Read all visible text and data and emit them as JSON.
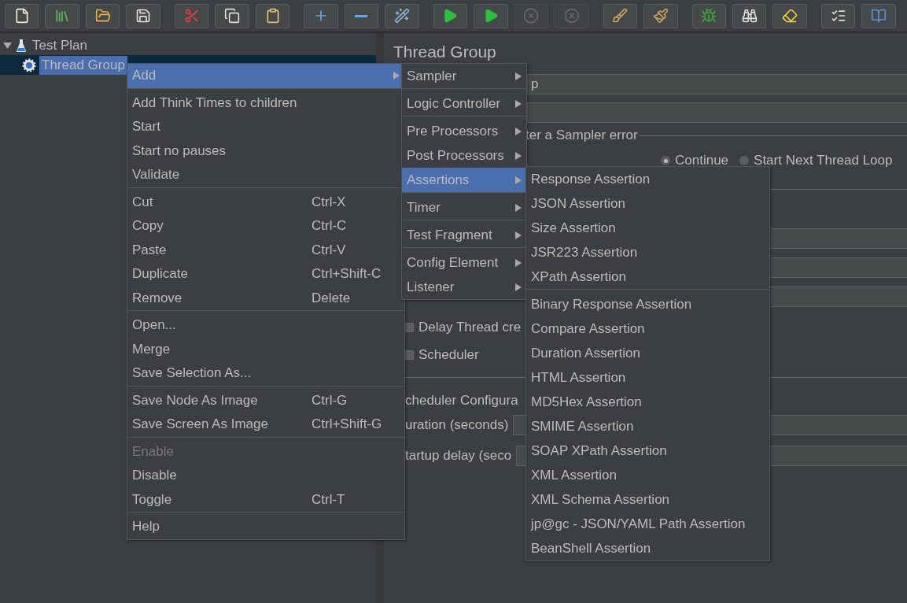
{
  "toolbar": [
    {
      "kind": "new",
      "disabled": false
    },
    {
      "kind": "templates",
      "disabled": false
    },
    {
      "kind": "open",
      "disabled": false
    },
    {
      "kind": "save",
      "disabled": false
    },
    {
      "kind": "cut",
      "disabled": false
    },
    {
      "kind": "copy",
      "disabled": false
    },
    {
      "kind": "paste",
      "disabled": false
    },
    {
      "kind": "expand",
      "disabled": false
    },
    {
      "kind": "collapse",
      "disabled": false
    },
    {
      "kind": "toggle",
      "disabled": false
    },
    {
      "kind": "start",
      "disabled": false
    },
    {
      "kind": "start-no-timers",
      "disabled": false
    },
    {
      "kind": "stop",
      "disabled": true
    },
    {
      "kind": "shutdown",
      "disabled": true
    },
    {
      "kind": "clear",
      "disabled": false
    },
    {
      "kind": "clear-all",
      "disabled": false
    },
    {
      "kind": "function-helper",
      "disabled": false
    },
    {
      "kind": "search",
      "disabled": false
    },
    {
      "kind": "reset-search",
      "disabled": false
    },
    {
      "kind": "log",
      "disabled": false
    },
    {
      "kind": "help",
      "disabled": false
    }
  ],
  "tree": [
    {
      "label": "Test Plan",
      "kind": "plan",
      "expanded": true,
      "selected": false,
      "children": [
        {
          "label": "Thread Group",
          "kind": "thread-group",
          "selected": true
        }
      ]
    }
  ],
  "panel": {
    "title": "Thread Group",
    "name_value": "p",
    "error_legend": "ter a Sampler error",
    "error_actions": [
      {
        "label": "Continue",
        "selected": true
      },
      {
        "label": "Start Next Thread Loop",
        "selected": false
      }
    ],
    "checkboxes": [
      {
        "label": "Delay Thread cre",
        "checked": false
      },
      {
        "label": "Scheduler",
        "checked": false
      }
    ],
    "scheduler_legend": "cheduler Configura",
    "scheduler_fields": [
      {
        "label": "uration (seconds)"
      },
      {
        "label": "tartup delay (seco"
      }
    ]
  },
  "context_menu": {
    "sections": [
      [
        {
          "label": "Add",
          "submenu": true,
          "selected": true,
          "disabled": false
        }
      ],
      [
        {
          "label": "Add Think Times to children",
          "selected": false,
          "disabled": false
        },
        {
          "label": "Start",
          "selected": false,
          "disabled": false
        },
        {
          "label": "Start no pauses",
          "selected": false,
          "disabled": false
        },
        {
          "label": "Validate",
          "selected": false,
          "disabled": false
        }
      ],
      [
        {
          "label": "Cut",
          "shortcut": "Ctrl-X",
          "selected": false,
          "disabled": false
        },
        {
          "label": "Copy",
          "shortcut": "Ctrl-C",
          "selected": false,
          "disabled": false
        },
        {
          "label": "Paste",
          "shortcut": "Ctrl-V",
          "selected": false,
          "disabled": false
        },
        {
          "label": "Duplicate",
          "shortcut": "Ctrl+Shift-C",
          "selected": false,
          "disabled": false
        },
        {
          "label": "Remove",
          "shortcut": "Delete",
          "selected": false,
          "disabled": false
        }
      ],
      [
        {
          "label": "Open...",
          "selected": false,
          "disabled": false
        },
        {
          "label": "Merge",
          "selected": false,
          "disabled": false
        },
        {
          "label": "Save Selection As...",
          "selected": false,
          "disabled": false
        }
      ],
      [
        {
          "label": "Save Node As Image",
          "shortcut": "Ctrl-G",
          "selected": false,
          "disabled": false
        },
        {
          "label": "Save Screen As Image",
          "shortcut": "Ctrl+Shift-G",
          "selected": false,
          "disabled": false
        }
      ],
      [
        {
          "label": "Enable",
          "selected": false,
          "disabled": true
        },
        {
          "label": "Disable",
          "selected": false,
          "disabled": false
        },
        {
          "label": "Toggle",
          "shortcut": "Ctrl-T",
          "selected": false,
          "disabled": false
        }
      ],
      [
        {
          "label": "Help",
          "selected": false,
          "disabled": false
        }
      ]
    ]
  },
  "add_menu": {
    "sections": [
      [
        {
          "label": "Sampler",
          "submenu": true,
          "selected": false
        }
      ],
      [
        {
          "label": "Logic Controller",
          "submenu": true,
          "selected": false
        }
      ],
      [
        {
          "label": "Pre Processors",
          "submenu": true,
          "selected": false
        },
        {
          "label": "Post Processors",
          "submenu": true,
          "selected": false
        },
        {
          "label": "Assertions",
          "submenu": true,
          "selected": true
        }
      ],
      [
        {
          "label": "Timer",
          "submenu": true,
          "selected": false
        }
      ],
      [
        {
          "label": "Test Fragment",
          "submenu": true,
          "selected": false
        }
      ],
      [
        {
          "label": "Config Element",
          "submenu": true,
          "selected": false
        },
        {
          "label": "Listener",
          "submenu": true,
          "selected": false
        }
      ]
    ]
  },
  "assertions_menu": {
    "sections": [
      [
        {
          "label": "Response Assertion",
          "selected": false
        },
        {
          "label": "JSON Assertion",
          "selected": false
        },
        {
          "label": "Size Assertion",
          "selected": false
        },
        {
          "label": "JSR223 Assertion",
          "selected": false
        },
        {
          "label": "XPath Assertion",
          "selected": false
        }
      ],
      [
        {
          "label": "Binary Response Assertion",
          "selected": false
        },
        {
          "label": "Compare Assertion",
          "selected": false
        },
        {
          "label": "Duration Assertion",
          "selected": false
        },
        {
          "label": "HTML Assertion",
          "selected": false
        },
        {
          "label": "MD5Hex Assertion",
          "selected": false
        },
        {
          "label": "SMIME Assertion",
          "selected": false
        },
        {
          "label": "SOAP XPath Assertion",
          "selected": false
        },
        {
          "label": "XML Assertion",
          "selected": false
        },
        {
          "label": "XML Schema Assertion",
          "selected": false
        },
        {
          "label": "jp@gc - JSON/YAML Path Assertion",
          "selected": false
        },
        {
          "label": "BeanShell Assertion",
          "selected": false
        }
      ]
    ]
  }
}
